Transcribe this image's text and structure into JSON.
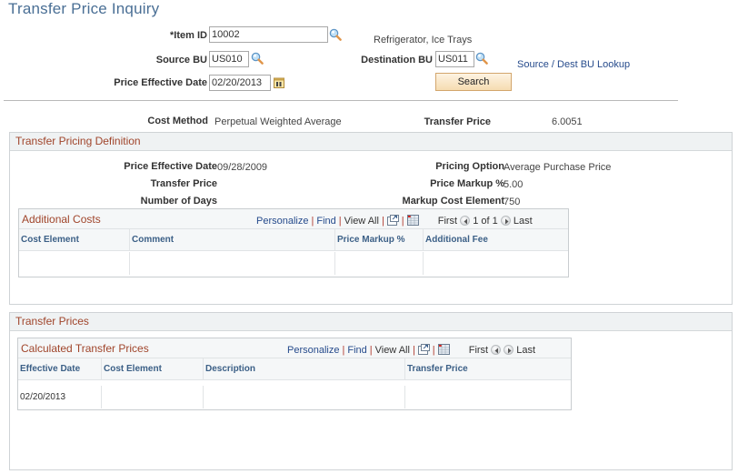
{
  "page": {
    "title": "Transfer Price Inquiry"
  },
  "search_form": {
    "item_id_label": "*Item ID",
    "item_id_value": "10002",
    "item_description": "Refrigerator, Ice Trays",
    "source_bu_label": "Source BU",
    "source_bu_value": "US010",
    "destination_bu_label": "Destination BU",
    "destination_bu_value": "US011",
    "lookup_link": "Source / Dest BU Lookup",
    "price_effective_date_label": "Price Effective Date",
    "price_effective_date_value": "02/20/2013",
    "search_button": "Search"
  },
  "summary": {
    "cost_method_label": "Cost Method",
    "cost_method_value": "Perpetual Weighted Average",
    "transfer_price_label": "Transfer Price",
    "transfer_price_value": "6.0051"
  },
  "definition": {
    "title": "Transfer Pricing Definition",
    "price_effective_date_label": "Price Effective Date",
    "price_effective_date_value": "09/28/2009",
    "transfer_price_label": "Transfer Price",
    "transfer_price_value": "",
    "number_of_days_label": "Number of Days",
    "number_of_days_value": "",
    "pricing_option_label": "Pricing Option",
    "pricing_option_value": "Average Purchase Price",
    "price_markup_label": "Price Markup %",
    "price_markup_value": "5.00",
    "markup_cost_element_label": "Markup Cost Element",
    "markup_cost_element_value": "750"
  },
  "additional_costs": {
    "title": "Additional Costs",
    "nav": {
      "personalize": "Personalize",
      "find": "Find",
      "view_all": "View All",
      "first": "First",
      "count": "1 of 1",
      "last": "Last"
    },
    "columns": [
      "Cost Element",
      "Comment",
      "Price Markup %",
      "Additional Fee"
    ],
    "rows": [
      [
        "",
        "",
        "",
        ""
      ]
    ]
  },
  "transfer_prices": {
    "title": "Transfer Prices",
    "grid": {
      "title": "Calculated Transfer Prices",
      "nav": {
        "personalize": "Personalize",
        "find": "Find",
        "view_all": "View All",
        "first": "First",
        "last": "Last"
      },
      "columns": [
        "Effective Date",
        "Cost Element",
        "Description",
        "Transfer Price"
      ],
      "rows": [
        [
          "02/20/2013",
          "",
          "",
          ""
        ]
      ]
    }
  }
}
